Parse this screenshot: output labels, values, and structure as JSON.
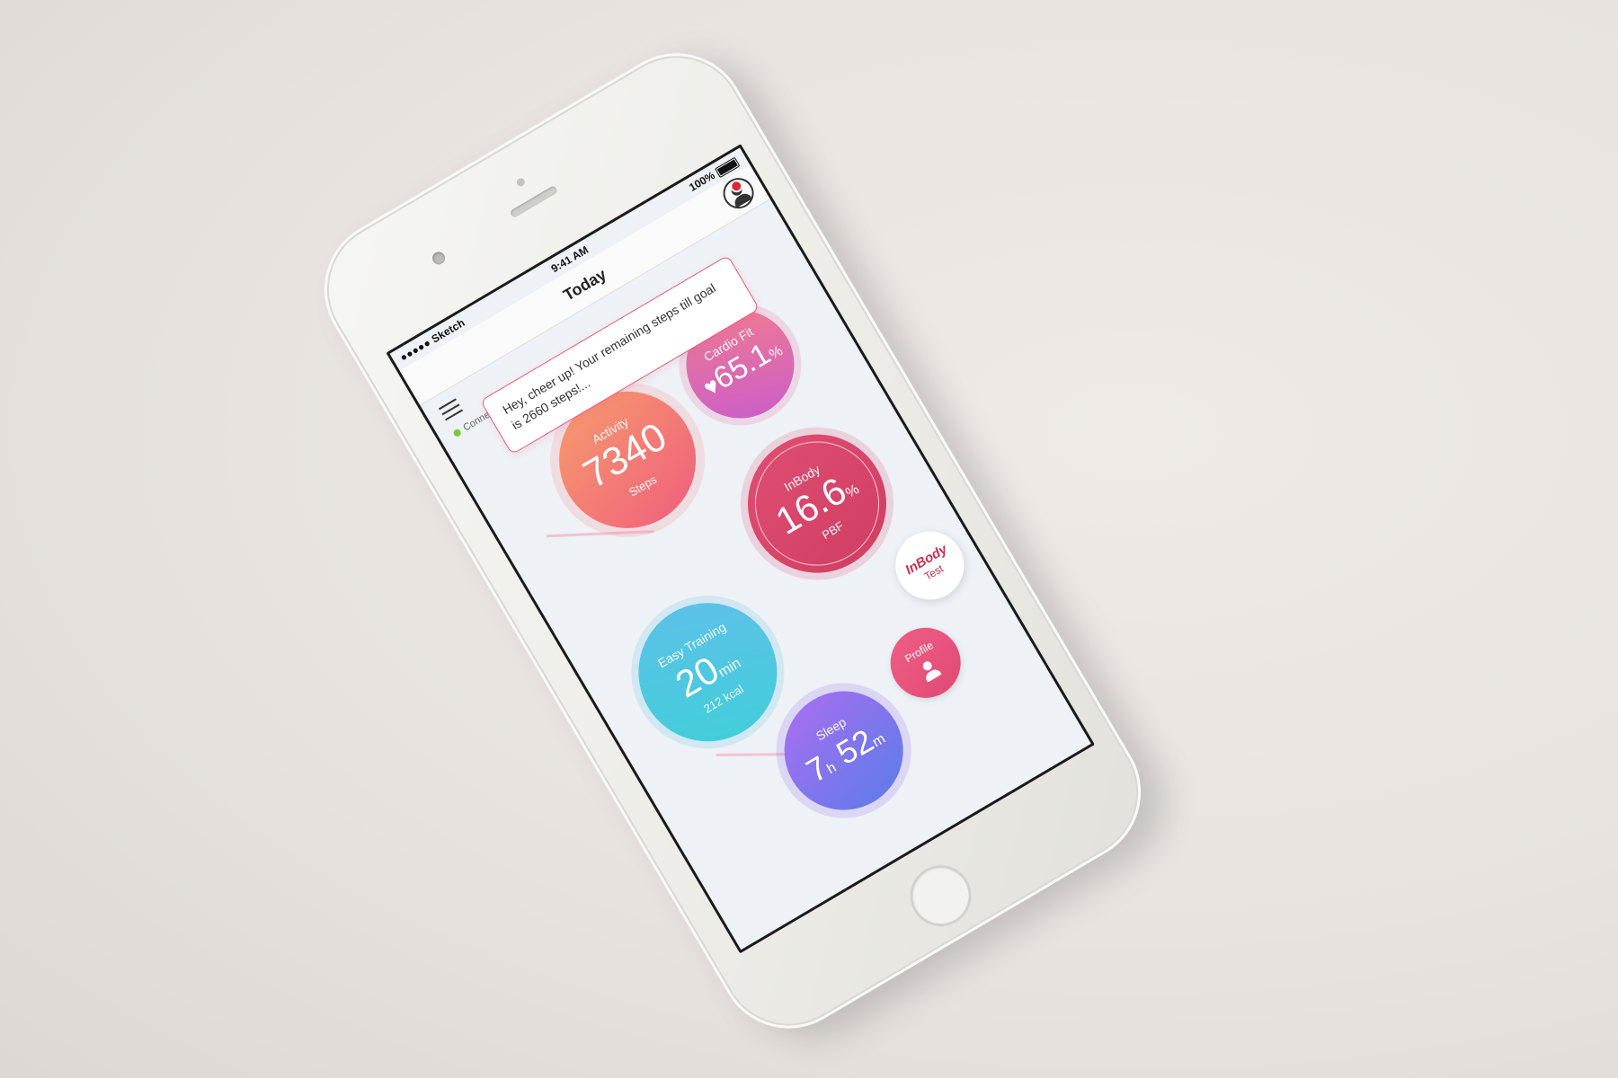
{
  "status_bar": {
    "carrier": "●●●●● Sketch",
    "time": "9:41 AM",
    "battery": "100%"
  },
  "nav": {
    "title": "Today"
  },
  "connection": {
    "label": "Connected"
  },
  "toast": {
    "message": "Hey, cheer up! Your remaining steps till goal is 2660 steps!..."
  },
  "bubbles": {
    "activity": {
      "label": "Activity",
      "value": "7340",
      "sub": "Steps"
    },
    "cardio": {
      "label": "Cardio Fit",
      "icon": "heart-icon",
      "value": "65.1",
      "unit": "%"
    },
    "inbody": {
      "label": "InBody",
      "value": "16.6",
      "unit": "%",
      "sub": "PBF"
    },
    "inbody_test": {
      "brand": "InBody",
      "label": "Test"
    },
    "training": {
      "label": "Easy Training",
      "value": "20",
      "unit": "min",
      "sub": "212 kcal"
    },
    "profile": {
      "label": "Profile",
      "icon": "person-icon"
    },
    "sleep": {
      "label": "Sleep",
      "hours": "7",
      "h_unit": "h",
      "minutes": "52",
      "m_unit": "m"
    }
  },
  "colors": {
    "activity": "#f0607c",
    "cardio": "#c95bcd",
    "inbody": "#d03e63",
    "training": "#3fcfd8",
    "sleep": "#5d7ce9",
    "toast_border": "#e55b7e",
    "notification": "#e3243b",
    "connected": "#7cc83b"
  }
}
